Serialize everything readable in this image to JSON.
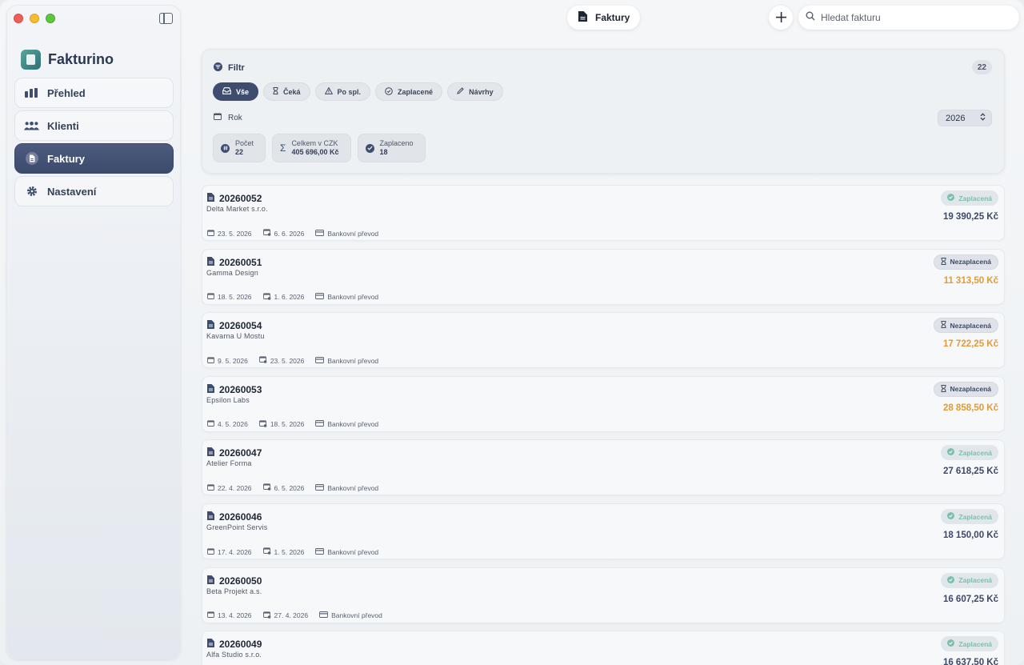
{
  "app": {
    "name": "Fakturino"
  },
  "sidebar": {
    "items": [
      {
        "label": "Přehled",
        "icon": "bar-chart-icon"
      },
      {
        "label": "Klienti",
        "icon": "people-icon"
      },
      {
        "label": "Faktury",
        "icon": "document-icon",
        "active": true
      },
      {
        "label": "Nastavení",
        "icon": "gear-icon"
      }
    ]
  },
  "toolbar": {
    "title": "Faktury",
    "search_placeholder": "Hledat fakturu"
  },
  "filter": {
    "title": "Filtr",
    "count": "22",
    "chips": [
      {
        "label": "Vše",
        "icon": "tray-icon",
        "active": true
      },
      {
        "label": "Čeká",
        "icon": "hourglass-icon"
      },
      {
        "label": "Po spl.",
        "icon": "warning-icon"
      },
      {
        "label": "Zaplacené",
        "icon": "check-circle-icon"
      },
      {
        "label": "Návrhy",
        "icon": "pencil-icon"
      }
    ],
    "year_label": "Rok",
    "year_value": "2026",
    "stats": [
      {
        "label": "Počet",
        "value": "22",
        "icon": "number-icon"
      },
      {
        "label": "Celkem v CZK",
        "value": "405 696,00 Kč",
        "icon": "sigma-icon"
      },
      {
        "label": "Zaplaceno",
        "value": "18",
        "icon": "check-circle-icon"
      }
    ]
  },
  "invoices": [
    {
      "number": "20260052",
      "client": "Delta Market s.r.o.",
      "issued": "23. 5. 2026",
      "due": "6. 6. 2026",
      "payment": "Bankovní převod",
      "status": "Zaplacená",
      "amount": "19 390,25 Kč",
      "paid": true
    },
    {
      "number": "20260051",
      "client": "Gamma Design",
      "issued": "18. 5. 2026",
      "due": "1. 6. 2026",
      "payment": "Bankovní převod",
      "status": "Nezaplacená",
      "amount": "11 313,50 Kč",
      "paid": false
    },
    {
      "number": "20260054",
      "client": "Kavarna U Mostu",
      "issued": "9. 5. 2026",
      "due": "23. 5. 2026",
      "payment": "Bankovní převod",
      "status": "Nezaplacená",
      "amount": "17 722,25 Kč",
      "paid": false
    },
    {
      "number": "20260053",
      "client": "Epsilon Labs",
      "issued": "4. 5. 2026",
      "due": "18. 5. 2026",
      "payment": "Bankovní převod",
      "status": "Nezaplacená",
      "amount": "28 858,50 Kč",
      "paid": false
    },
    {
      "number": "20260047",
      "client": "Atelier Forma",
      "issued": "22. 4. 2026",
      "due": "6. 5. 2026",
      "payment": "Bankovní převod",
      "status": "Zaplacená",
      "amount": "27 618,25 Kč",
      "paid": true
    },
    {
      "number": "20260046",
      "client": "GreenPoint Servis",
      "issued": "17. 4. 2026",
      "due": "1. 5. 2026",
      "payment": "Bankovní převod",
      "status": "Zaplacená",
      "amount": "18 150,00 Kč",
      "paid": true
    },
    {
      "number": "20260050",
      "client": "Beta Projekt a.s.",
      "issued": "13. 4. 2026",
      "due": "27. 4. 2026",
      "payment": "Bankovní převod",
      "status": "Zaplacená",
      "amount": "16 607,25 Kč",
      "paid": true
    },
    {
      "number": "20260049",
      "client": "Alfa Studio s.r.o.",
      "issued": "",
      "due": "",
      "payment": "",
      "status": "Zaplacená",
      "amount": "16 637,50 Kč",
      "paid": true
    }
  ],
  "colors": {
    "accent": "#3e4c6e",
    "paid_status": "#7dbfae",
    "unpaid_amount": "#e09a3a",
    "paid_amount": "#3d4966"
  }
}
